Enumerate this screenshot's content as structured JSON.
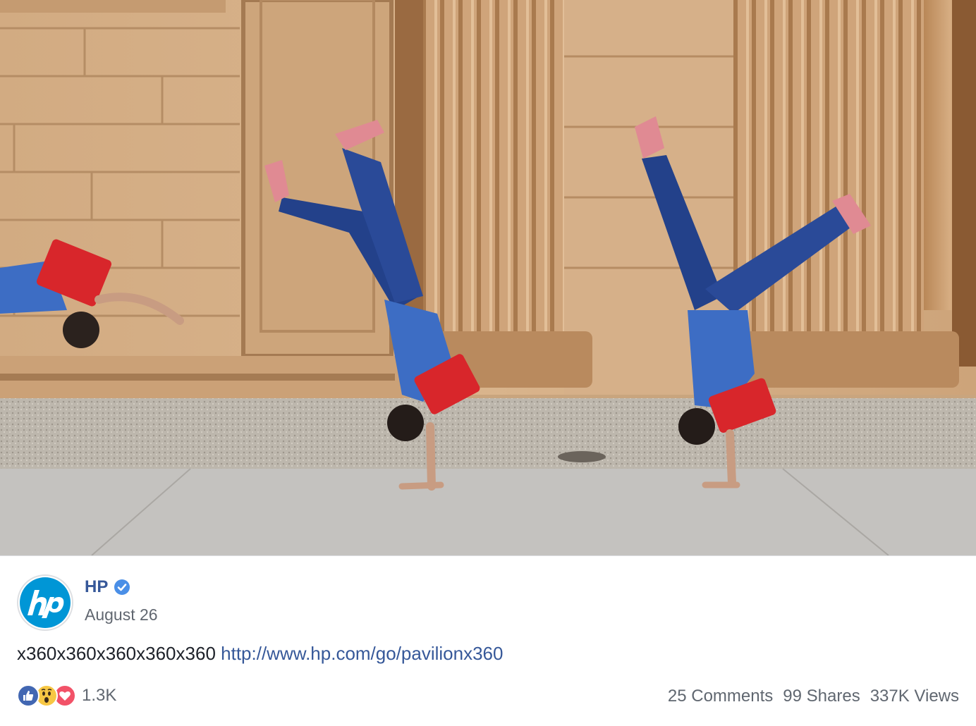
{
  "post": {
    "page_name": "HP",
    "date": "August 26",
    "text": "x360x360x360x360x360",
    "link": "http://www.hp.com/go/pavilionx360",
    "reactions": {
      "types": [
        "like-icon",
        "wow-icon",
        "love-icon"
      ],
      "count": "1.3K"
    },
    "stats": {
      "comments": "25 Comments",
      "shares": "99 Shares",
      "views": "337K Views"
    }
  },
  "media": {
    "description": "video-thumbnail"
  },
  "colors": {
    "link": "#365899",
    "hp_blue": "#0096d6",
    "verified": "#4a8fe7",
    "like": "#4267b2",
    "wow": "#f7c744",
    "love": "#f25268"
  },
  "logo_text": "hp"
}
